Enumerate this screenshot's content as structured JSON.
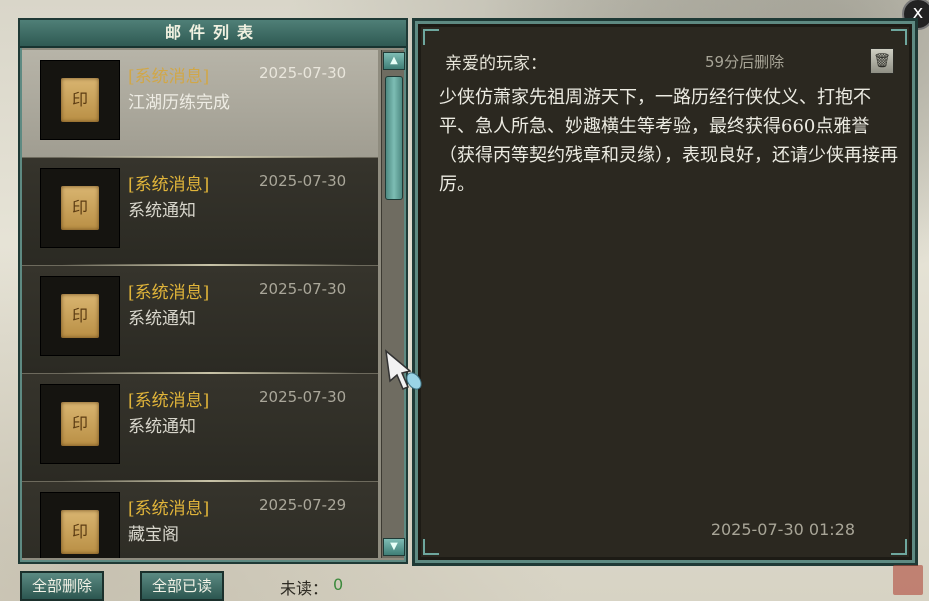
{
  "left_panel": {
    "title": "邮件列表"
  },
  "mails": [
    {
      "tag": "[系统消息]",
      "date": "2025-07-30",
      "subject": "江湖历练完成",
      "selected": true
    },
    {
      "tag": "[系统消息]",
      "date": "2025-07-30",
      "subject": "系统通知",
      "selected": false
    },
    {
      "tag": "[系统消息]",
      "date": "2025-07-30",
      "subject": "系统通知",
      "selected": false
    },
    {
      "tag": "[系统消息]",
      "date": "2025-07-30",
      "subject": "系统通知",
      "selected": false
    },
    {
      "tag": "[系统消息]",
      "date": "2025-07-29",
      "subject": "藏宝阁",
      "selected": false
    }
  ],
  "detail": {
    "greeting": "亲爱的玩家：",
    "expire": "59分后删除",
    "body": "少侠仿萧家先祖周游天下，一路历经行侠仗义、打抱不平、急人所急、妙趣横生等考验，最终获得660点雅誉（获得丙等契约残章和灵缘），表现良好，还请少侠再接再厉。",
    "sent_time": "2025-07-30  01:28"
  },
  "footer": {
    "delete_all": "全部删除",
    "read_all": "全部已读",
    "unread_label": "未读：",
    "unread_count": "0"
  },
  "close_label": "x",
  "scroll": {
    "up": "▲",
    "down": "▼"
  },
  "trash_glyph": "🗑",
  "icons": [
    "close-icon",
    "trash-icon",
    "scroll-up-icon",
    "scroll-down-icon",
    "cursor-icon"
  ],
  "colors": {
    "accent": "#5e8a82",
    "tag": "#e0b43a",
    "unread": "#3d8a3d"
  }
}
